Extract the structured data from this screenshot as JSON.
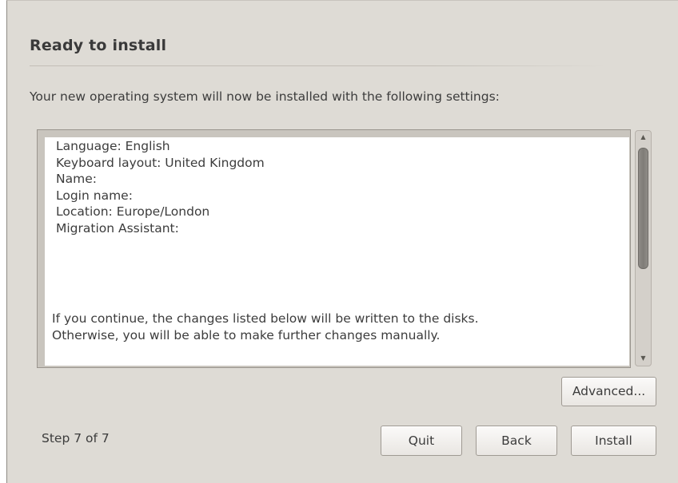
{
  "page": {
    "title": "Ready to install",
    "intro": "Your new operating system will now be installed with the following settings:"
  },
  "summary": {
    "settings": [
      "Language: English",
      "Keyboard layout: United Kingdom",
      "Name:",
      "Login name:",
      "Location: Europe/London",
      "Migration Assistant:"
    ],
    "notice": [
      "If you continue, the changes listed below will be written to the disks.",
      "Otherwise, you will be able to make further changes manually."
    ]
  },
  "scrollbar": {
    "up_icon": "scroll-up-arrow",
    "down_icon": "scroll-down-arrow",
    "up_glyph": "▲",
    "down_glyph": "▼"
  },
  "buttons": {
    "advanced": "Advanced...",
    "quit": "Quit",
    "back": "Back",
    "install": "Install"
  },
  "footer": {
    "step": "Step 7 of 7"
  },
  "colors": {
    "window_bg": "#dedbd5",
    "text": "#3c3c3c",
    "textview_bg": "#ffffff",
    "scroll_thumb": "#84817c"
  }
}
